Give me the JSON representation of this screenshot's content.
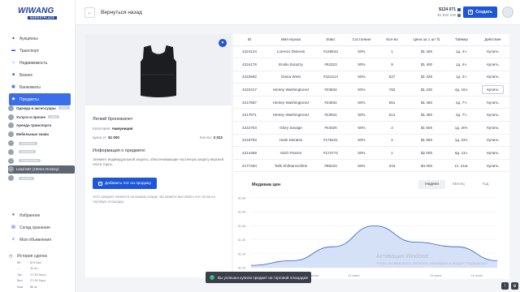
{
  "brand": {
    "name": "WIWANG",
    "sub": "MARKETPLACE"
  },
  "sidebar": {
    "items": [
      {
        "label": "Аукционы",
        "icon": "auction-icon"
      },
      {
        "label": "Транспорт",
        "icon": "car-icon"
      },
      {
        "label": "Недвижимость",
        "icon": "house-icon"
      },
      {
        "label": "Бизнес",
        "icon": "briefcase-icon"
      },
      {
        "label": "Банкоматы",
        "icon": "atm-icon"
      },
      {
        "label": "Предметы",
        "icon": "box-icon"
      }
    ],
    "users": [
      {
        "name": "Одежда и аксессуары",
        "msg": ""
      },
      {
        "name": "Услуги и прочее",
        "msg": ""
      },
      {
        "name": "Аренда транспорта",
        "msg": ""
      },
      {
        "name": "Мебельные знаки",
        "msg": ""
      },
      {
        "name": "",
        "msg": ""
      },
      {
        "name": "",
        "msg": ""
      },
      {
        "name": "",
        "msg": ""
      },
      {
        "name": "Lead MO (100ms Rockey)",
        "msg": ""
      },
      {
        "name": "",
        "msg": ""
      }
    ],
    "secondary": [
      {
        "label": "Избранное",
        "icon": "heart-icon"
      },
      {
        "label": "Склад хранения",
        "icon": "warehouse-icon"
      },
      {
        "label": "Мои объявления",
        "icon": "list-icon"
      }
    ],
    "history": {
      "title": "История сделок",
      "rows": [
        {
          "id": "ffff",
          "val": "$75 бан"
        },
        {
          "id": "---",
          "val": "30 ян"
        },
        {
          "id": "Tan",
          "val": "27:35 Nano"
        },
        {
          "id": "Ban",
          "val": "27:35 Sapo"
        },
        {
          "id": "Вам",
          "val": "$6 sn"
        }
      ]
    }
  },
  "topbar": {
    "back_label": "Вернуться назад",
    "balance_primary": "$124 071",
    "balance_secondary": "$1 832 219",
    "create_label": "Создать"
  },
  "product": {
    "title": "Легкий бронежилет",
    "category_label": "Категория:",
    "category_value": "Аммуниция",
    "price_label": "Цена от:",
    "price_value": "$1 000",
    "qty_label": "Кол-во:",
    "qty_value": "3 313",
    "info_title": "Информация о предмете:",
    "info_text": "Элемент индивидуальной защиты, обеспечивающие частичную защиту верхней части торса.",
    "add_label": "Добавить лот на продажу",
    "note": "Этот предмет появится на вашем складе. Вы можете выставить его потом на торговую площадку."
  },
  "table": {
    "headers": [
      "ID",
      "Имя игрока",
      "Static",
      "Состояние",
      "Кол-во",
      "Цена за 1 шт",
      "Таймер",
      "Действие"
    ],
    "rows": [
      [
        "4224124",
        "Lorenzo Distress",
        "#148643",
        "50%",
        "1",
        "$1 400",
        "1д. 4ч.",
        "Купить"
      ],
      [
        "4224178",
        "Emilio Extazzy",
        "#52323",
        "50%",
        "9",
        "$1 400",
        "1д. 4ч.",
        "Купить"
      ],
      [
        "4222582",
        "Diana West",
        "#161314",
        "50%",
        "627",
        "$1 429",
        "1д. 2ч.",
        "Купить"
      ],
      [
        "4222417",
        "Hentey Washingtonez",
        "#23834",
        "50%",
        "782",
        "$1 430",
        "4д. 15ч.",
        "Купить"
      ],
      [
        "4217867",
        "Hentey Washingtonez",
        "#23834",
        "50%",
        "561",
        "$1 450",
        "4д. 7ч.",
        "Купить"
      ],
      [
        "4217871",
        "Hentey Washingtonez",
        "#23834",
        "50%",
        "614",
        "$1 450",
        "4д. 7ч.",
        "Купить"
      ],
      [
        "4222754",
        "Glory Savage",
        "#44026",
        "50%",
        "2",
        "$1 500",
        "1д. 20ч.",
        "Купить"
      ],
      [
        "4218793",
        "Hank Morales",
        "#176241",
        "50%",
        "2",
        "$1 550",
        "1д. 23ч.",
        "Купить"
      ],
      [
        "4214468",
        "Akich Panzer",
        "#174772",
        "50%",
        "1",
        "$2 000",
        "6д. 11ч.",
        "Купить"
      ],
      [
        "4177494",
        "Tolik Shihtarovchkin",
        "#96233",
        "50%",
        "243",
        "$4 000",
        "1ч. 41м.",
        "Купить"
      ]
    ]
  },
  "chart_data": {
    "type": "area",
    "title": "Медиана цен",
    "tabs": [
      "Неделя",
      "Месяц",
      "Год"
    ],
    "active_tab": "Неделя",
    "y_ticks": [
      "$1.8К",
      "$1.6К",
      "$1.5К",
      "$1.4К",
      "$1.3К",
      "$1.2К"
    ],
    "x_ticks": [
      "",
      "12 июня",
      "13 июня",
      "",
      "15 июня",
      "16 июня"
    ],
    "x": [
      0,
      1,
      2,
      3,
      4,
      5,
      6
    ],
    "values": [
      1.22,
      1.26,
      1.38,
      1.56,
      1.42,
      1.38,
      1.26
    ]
  },
  "watermark": {
    "line1": "Активация Windows",
    "line2": "Чтобы активировать Windows, перейдите в раздел \"Параметры\""
  },
  "toast": {
    "text": "Вы успешно купили предмет на торговой площадке!"
  },
  "colors": {
    "accent": "#1d56d6",
    "active_nav": "#3b6ee8",
    "chart_fill": "#c9d9f5",
    "chart_line": "#2f5fd0"
  }
}
